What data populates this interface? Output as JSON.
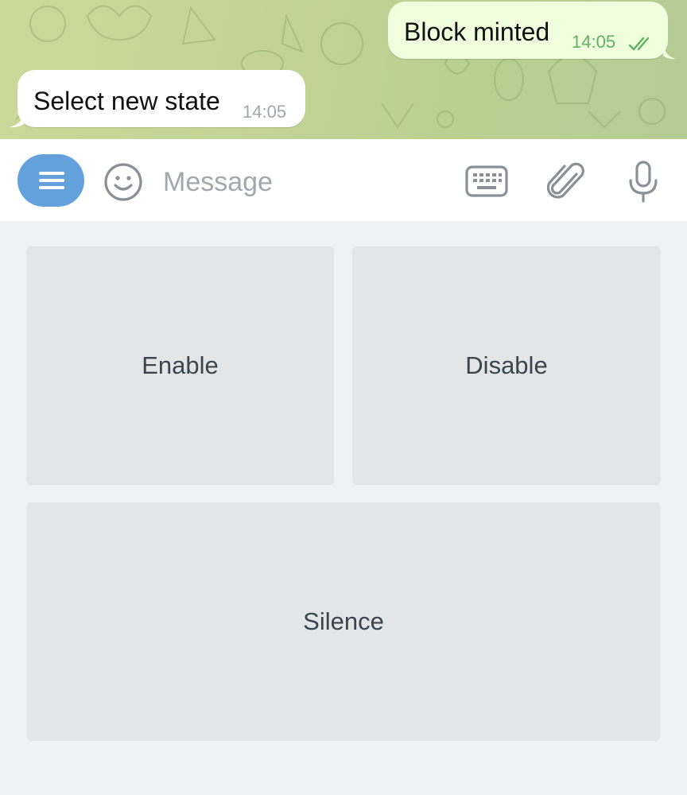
{
  "messages": [
    {
      "direction": "outgoing",
      "text": "Block minted",
      "time": "14:05",
      "status": "read-double-check-icon"
    },
    {
      "direction": "incoming",
      "text": "Select new state",
      "time": "14:05"
    }
  ],
  "input": {
    "placeholder": "Message",
    "icons": [
      "menu-icon",
      "emoji-icon",
      "keyboard-icon",
      "attach-icon",
      "microphone-icon"
    ]
  },
  "keyboard": {
    "buttons": [
      "Enable",
      "Disable",
      "Silence"
    ]
  },
  "colors": {
    "accent": "#64a1dc",
    "outgoing_bubble": "#effedd",
    "read_check": "#5fb35f",
    "chat_background": "#c2d596"
  }
}
